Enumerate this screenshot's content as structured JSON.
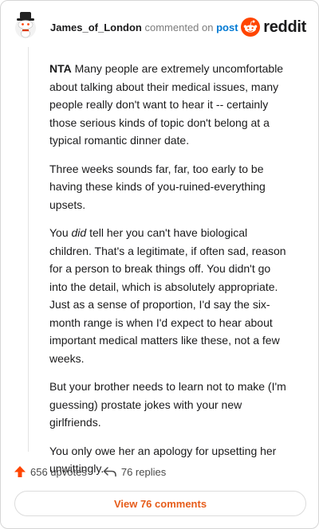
{
  "header": {
    "username": "James_of_London",
    "action": "commented on",
    "post_link": "post",
    "brand": "reddit"
  },
  "comment": {
    "lead": "NTA",
    "paragraphs": {
      "p1_rest": " Many people are extremely uncomfortable about talking about their medical issues, many people really don't want to hear it -- certainly those serious kinds of topic don't belong at a typical romantic dinner date.",
      "p2": "Three weeks sounds far, far, too early to be having these kinds of you-ruined-everything upsets.",
      "p3_pre": "You ",
      "p3_em": "did",
      "p3_post": " tell her you can't have biological children. That's a legitimate, if often sad, reason for a person to break things off. You didn't go into the detail, which is absolutely appropriate. Just as a sense of proportion, I'd say the six-month range is when I'd expect to hear about important medical matters like these, not a few weeks.",
      "p4": "But your brother needs to learn not to make (I'm guessing) prostate jokes with your new girlfriends.",
      "p5": "You only owe her an apology for upsetting her unwittingly."
    }
  },
  "footer": {
    "upvotes": "656 upvotes",
    "replies": "76 replies",
    "view_comments": "View 76 comments"
  },
  "colors": {
    "brand_orange": "#ff4500",
    "link_blue": "#0079d3",
    "button_text": "#e65c1a"
  },
  "icons": {
    "avatar": "snoo-avatar-with-hat",
    "logo": "reddit-alien-logo",
    "upvote": "upvote-arrow-icon",
    "reply": "reply-arrow-icon"
  }
}
